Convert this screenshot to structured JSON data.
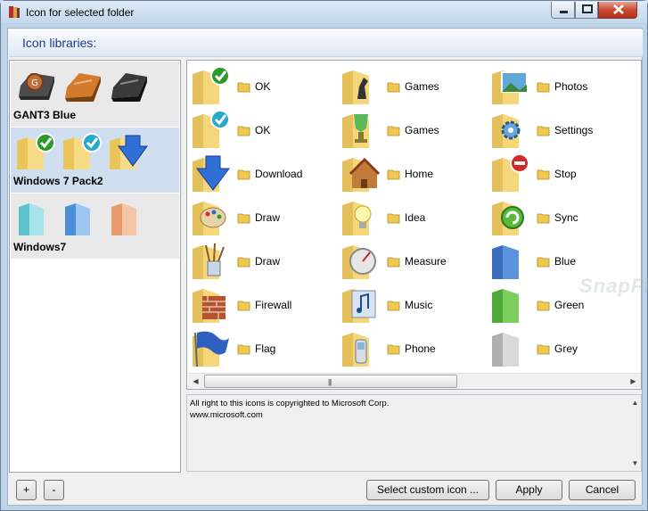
{
  "window": {
    "title": "Icon for selected folder",
    "minimize_icon": "minimize-icon",
    "maximize_icon": "maximize-icon",
    "close_icon": "close-icon"
  },
  "header": {
    "title": "Icon libraries:"
  },
  "libraries": [
    {
      "name": "GANT3 Blue",
      "selected": false
    },
    {
      "name": "Windows 7 Pack2",
      "selected": true
    },
    {
      "name": "Windows7",
      "selected": false
    }
  ],
  "icons": [
    {
      "label": "OK",
      "icon": "folder-check-green-icon"
    },
    {
      "label": "Games",
      "icon": "folder-chess-icon"
    },
    {
      "label": "Photos",
      "icon": "folder-photo-icon"
    },
    {
      "label": "OK",
      "icon": "folder-check-blue-icon"
    },
    {
      "label": "Games",
      "icon": "folder-trophy-icon"
    },
    {
      "label": "Settings",
      "icon": "folder-gear-icon"
    },
    {
      "label": "Download",
      "icon": "download-arrow-icon"
    },
    {
      "label": "Home",
      "icon": "folder-home-icon"
    },
    {
      "label": "Stop",
      "icon": "folder-stop-icon"
    },
    {
      "label": "Draw",
      "icon": "folder-palette-icon"
    },
    {
      "label": "Idea",
      "icon": "folder-bulb-icon"
    },
    {
      "label": "Sync",
      "icon": "folder-sync-icon"
    },
    {
      "label": "Draw",
      "icon": "folder-brushes-icon"
    },
    {
      "label": "Measure",
      "icon": "folder-gauge-icon"
    },
    {
      "label": "Blue",
      "icon": "folder-blue-icon"
    },
    {
      "label": "Firewall",
      "icon": "folder-firewall-icon"
    },
    {
      "label": "Music",
      "icon": "folder-music-icon"
    },
    {
      "label": "Green",
      "icon": "folder-green-icon"
    },
    {
      "label": "Flag",
      "icon": "folder-flag-icon"
    },
    {
      "label": "Phone",
      "icon": "folder-phone-icon"
    },
    {
      "label": "Grey",
      "icon": "folder-grey-icon"
    }
  ],
  "copyright": {
    "line1": "All right to this icons is copyrighted to Microsoft Corp.",
    "line2": "www.microsoft.com"
  },
  "buttons": {
    "add": "+",
    "remove": "-",
    "custom": "Select custom icon ...",
    "apply": "Apply",
    "cancel": "Cancel"
  },
  "watermark": "SnapFiles",
  "colors": {
    "folder": "#f5d77a",
    "header_text": "#1e3a8a",
    "selection": "#cfdff0"
  }
}
